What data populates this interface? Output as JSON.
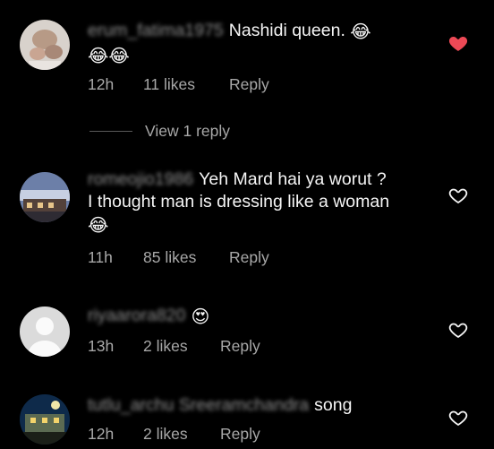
{
  "comments": [
    {
      "username": "erum_fatima1975",
      "text": "Nashidi queen.",
      "emoji_inline": "😂",
      "emoji_line2": "😂😂",
      "time": "12h",
      "likes": "11 likes",
      "reply": "Reply",
      "liked": true
    },
    {
      "username": "romeojio1986",
      "text_line1": "Yeh Mard hai ya worut ?",
      "text_line2": "I thought man is dressing like a woman",
      "emoji_line3": "😂",
      "time": "11h",
      "likes": "85 likes",
      "reply": "Reply",
      "liked": false
    },
    {
      "username": "riyaarora820",
      "emoji": "😍",
      "time": "13h",
      "likes": "2 likes",
      "reply": "Reply",
      "liked": false
    },
    {
      "username": "tutlu_archu Sreeramchandra",
      "text": "song",
      "time": "12h",
      "likes": "2 likes",
      "reply": "Reply",
      "liked": false
    }
  ],
  "view_replies": "View 1 reply",
  "colors": {
    "background": "#000000",
    "text": "#f5f5f5",
    "meta": "#a8a8a8",
    "liked_heart": "#ed4956"
  },
  "icons": [
    "heart-filled-icon",
    "heart-outline-icon",
    "default-avatar-icon"
  ]
}
